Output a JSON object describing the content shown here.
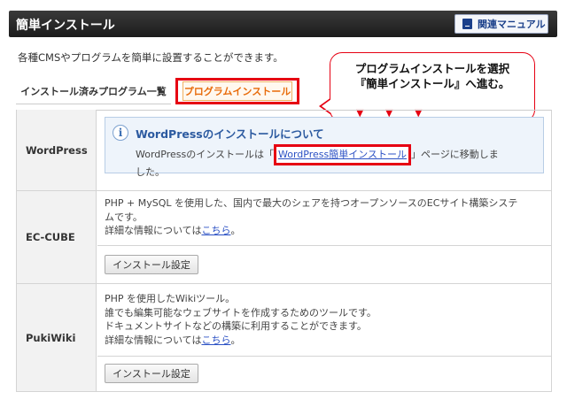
{
  "header": {
    "title": "簡単インストール",
    "manual_button": "関連マニュアル",
    "manual_icon": "book-icon"
  },
  "intro": "各種CMSやプログラムを簡単に設置することができます。",
  "tabs": [
    {
      "label": "インストール済みプログラム一覧",
      "active": false
    },
    {
      "label": "プログラムインストール",
      "active": true
    }
  ],
  "callout": {
    "line1": "プログラムインストールを選択",
    "line2": "『簡単インストール』へ進む。",
    "arrow": "▼"
  },
  "rows": [
    {
      "name": "WordPress",
      "info_title": "WordPressのインストールについて",
      "info_text_before": "WordPressのインストールは「",
      "info_link": "WordPress簡単インストール",
      "info_text_after": "」ページに移動しま",
      "info_text_line2": "した。"
    },
    {
      "name": "EC-CUBE",
      "desc_line1": "PHP + MySQL を使用した、国内で最大のシェアを持つオープンソースのECサイト構築システ",
      "desc_line2": "ムです。",
      "desc_more_prefix": "詳細な情報については",
      "desc_more_link": "こちら",
      "desc_more_suffix": "。",
      "button": "インストール設定"
    },
    {
      "name": "PukiWiki",
      "desc_line1": "PHP を使用したWikiツール。",
      "desc_line2": "誰でも編集可能なウェブサイトを作成するためのツールです。",
      "desc_line3": "ドキュメントサイトなどの構築に利用することができます。",
      "desc_more_prefix": "詳細な情報については",
      "desc_more_link": "こちら",
      "desc_more_suffix": "。",
      "button": "インストール設定"
    }
  ],
  "colors": {
    "highlight": "#e60012",
    "link": "#2b51c4",
    "header_bg": "#1c1c1c"
  }
}
